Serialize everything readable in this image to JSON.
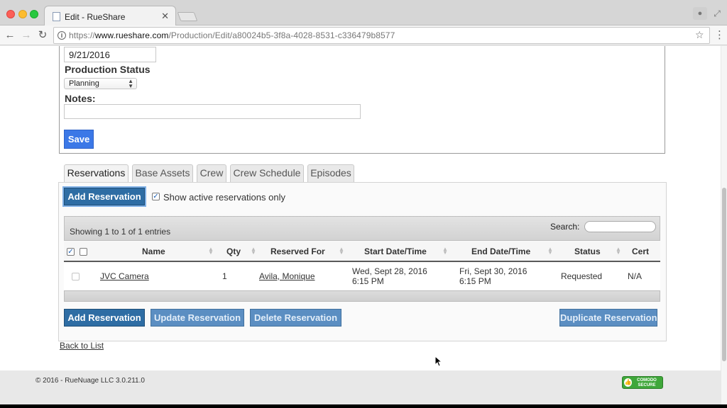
{
  "browser": {
    "tab_title": "Edit - RueShare",
    "url_prefix": "https://",
    "url_host": "www.rueshare.com",
    "url_path": "/Production/Edit/a80024b5-3f8a-4028-8531-c336479b8577"
  },
  "form": {
    "date_value": "9/21/2016",
    "production_status_label": "Production Status",
    "production_status_value": "Planning",
    "notes_label": "Notes:",
    "notes_value": "",
    "save_label": "Save"
  },
  "tabs": [
    {
      "label": "Reservations",
      "active": true
    },
    {
      "label": "Base Assets",
      "active": false
    },
    {
      "label": "Crew",
      "active": false
    },
    {
      "label": "Crew Schedule",
      "active": false
    },
    {
      "label": "Episodes",
      "active": false
    }
  ],
  "reservations": {
    "add_label": "Add Reservation",
    "active_only_label": "Show active reservations only",
    "active_only_checked": true,
    "showing_text": "Showing 1 to 1 of 1 entries",
    "search_label": "Search:",
    "search_value": "",
    "columns": [
      "Name",
      "Qty",
      "Reserved For",
      "Start Date/Time",
      "End Date/Time",
      "Status",
      "Cert"
    ],
    "rows": [
      {
        "name": "JVC Camera",
        "qty": "1",
        "reserved_for": "Avila, Monique",
        "start_line1": "Wed, Sept 28, 2016",
        "start_line2": "6:15 PM",
        "end_line1": "Fri, Sept 30, 2016",
        "end_line2": "6:15 PM",
        "status": "Requested",
        "cert": "N/A"
      }
    ],
    "buttons": {
      "add": "Add Reservation",
      "update": "Update Reservation",
      "delete": "Delete Reservation",
      "duplicate": "Duplicate Reservation"
    }
  },
  "back_link": "Back to List",
  "footer": {
    "copyright": "© 2016 - RueNuage LLC 3.0.211.0",
    "badge_line1": "COMODO",
    "badge_line2": "SECURE"
  }
}
